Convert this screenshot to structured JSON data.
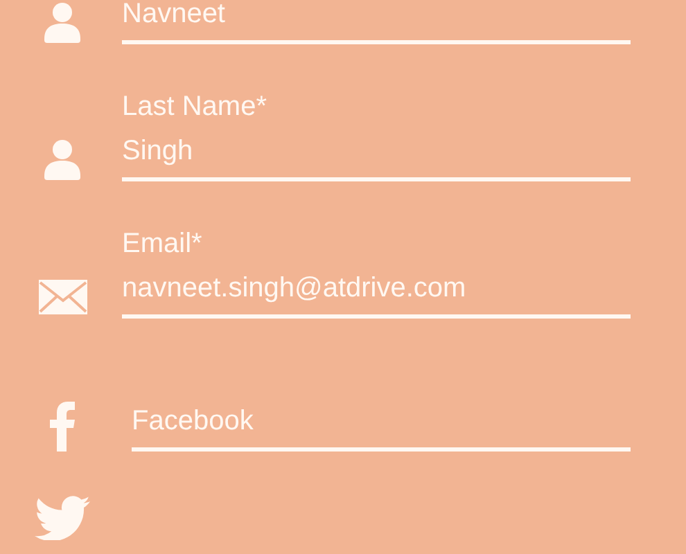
{
  "fields": [
    {
      "kind": "person",
      "value": "Navneet"
    },
    {
      "kind": "person",
      "label": "Last Name*",
      "value": "Singh"
    },
    {
      "kind": "email",
      "label": "Email*",
      "value": "navneet.singh@atdrive.com"
    },
    {
      "kind": "facebook",
      "placeholder": "Facebook"
    },
    {
      "kind": "twitter"
    }
  ]
}
